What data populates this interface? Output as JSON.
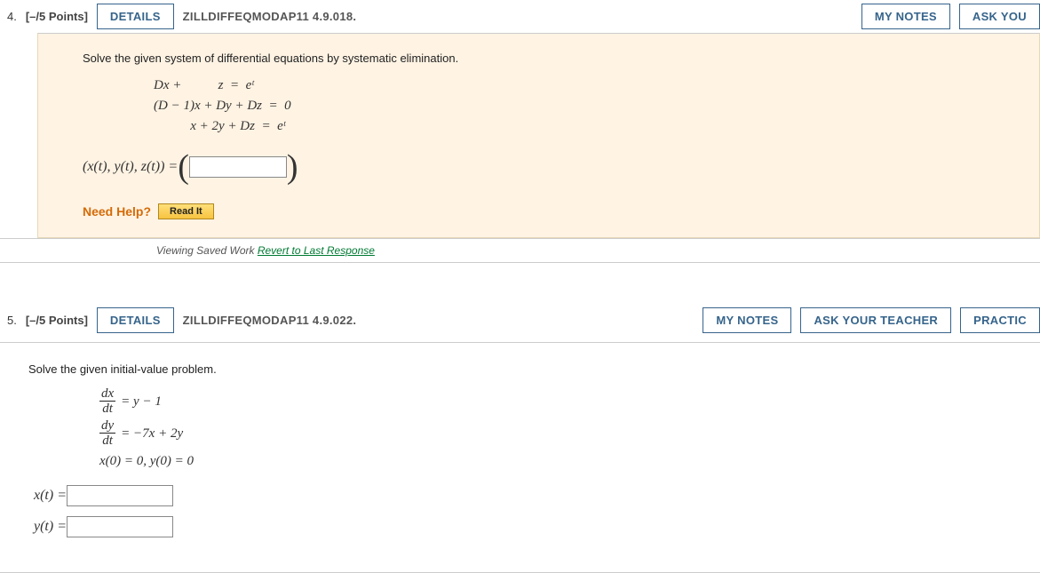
{
  "common": {
    "details_btn": "DETAILS",
    "my_notes_btn": "MY NOTES",
    "ask_teacher_btn": "ASK YOUR TEACHER",
    "ask_teacher_cut": "ASK YOU",
    "practice_cut": "PRACTIC",
    "need_help": "Need Help?",
    "read_it": "Read It"
  },
  "q4": {
    "number": "4.",
    "points": "[–/5 Points]",
    "ref": "ZILLDIFFEQMODAP11 4.9.018.",
    "prompt": "Solve the given system of differential equations by systematic elimination.",
    "eq1_left": "Dx +           z",
    "eq1_right": "eᵗ",
    "eq2_left": "(D − 1)x + Dy + Dz",
    "eq2_right": "0",
    "eq3_left": "x + 2y + Dz",
    "eq3_right": "eᵗ",
    "answer_label": "(x(t), y(t), z(t)) = ",
    "saved_work": "Viewing Saved Work ",
    "revert": "Revert to Last Response"
  },
  "q5": {
    "number": "5.",
    "points": "[–/5 Points]",
    "ref": "ZILLDIFFEQMODAP11 4.9.022.",
    "prompt": "Solve the given initial-value problem.",
    "eq1_rhs": "= y − 1",
    "eq2_rhs": "= −7x + 2y",
    "ic": "x(0) = 0, y(0) = 0",
    "x_label": "x(t) = ",
    "y_label": "y(t) = "
  }
}
